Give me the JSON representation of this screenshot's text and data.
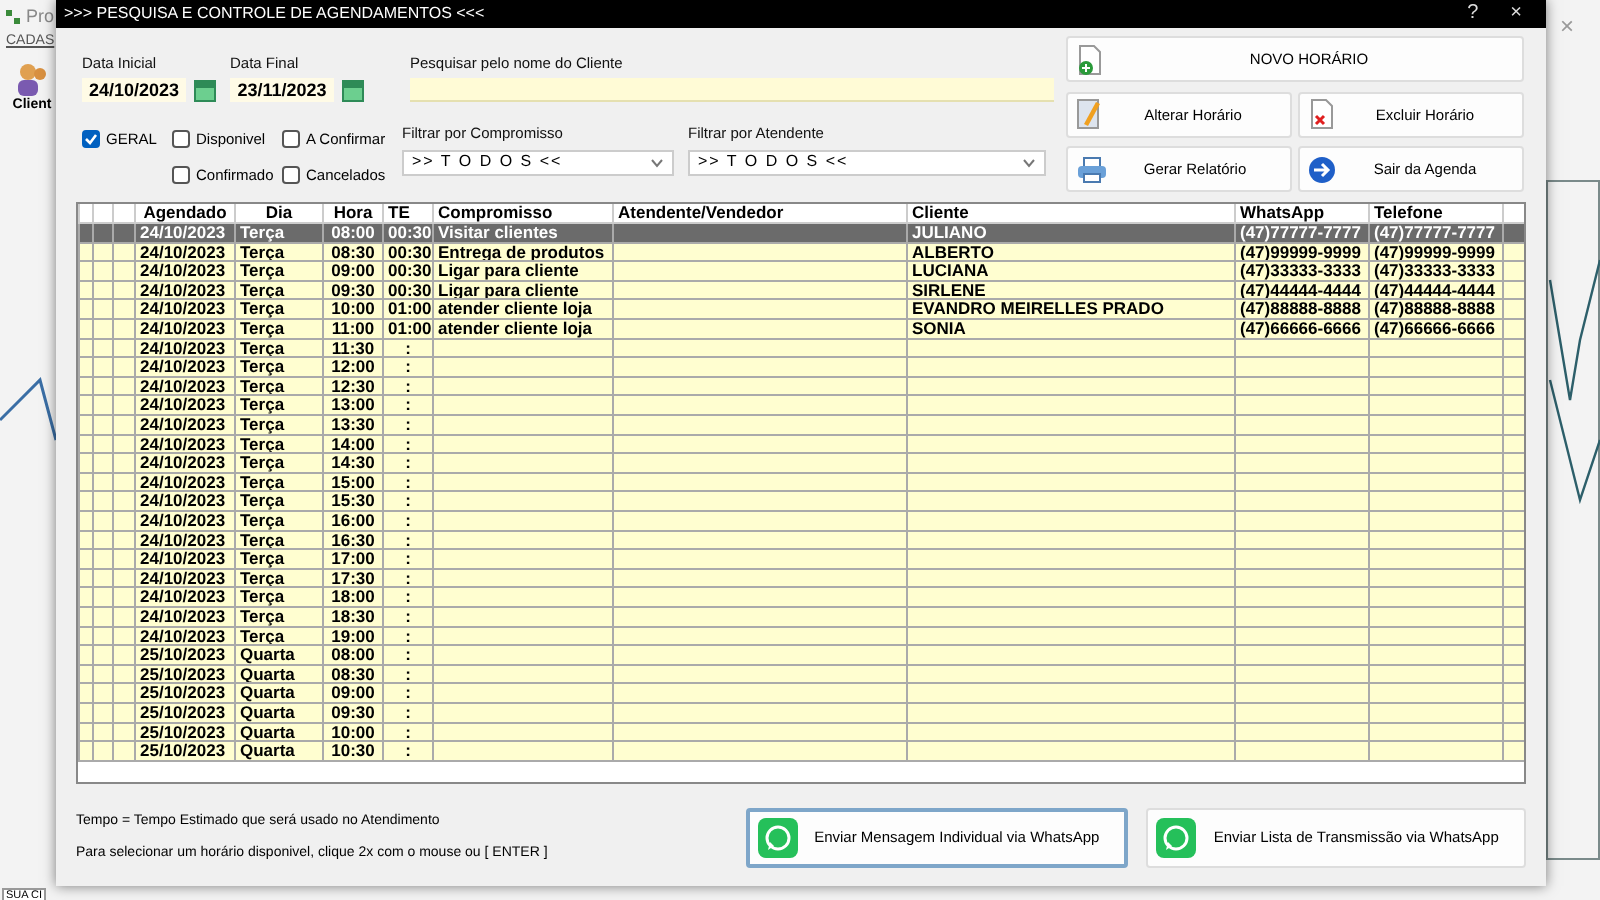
{
  "background_app": {
    "title": "Pro",
    "menu": "CADAS",
    "toolbar_label": "Client",
    "status_text": "SUA CI",
    "close": "×"
  },
  "dialog": {
    "title": ">>>  PESQUISA E CONTROLE DE AGENDAMENTOS  <<<",
    "help": "?",
    "close": "×"
  },
  "date_start": {
    "label": "Data Inicial",
    "value": "24/10/2023"
  },
  "date_end": {
    "label": "Data Final",
    "value": "23/11/2023"
  },
  "search": {
    "label": "Pesquisar pelo nome do Cliente"
  },
  "filters": [
    {
      "label": "GERAL",
      "checked": true
    },
    {
      "label": "Disponivel",
      "checked": false
    },
    {
      "label": "A Confirmar",
      "checked": false
    },
    {
      "label": "Confirmado",
      "checked": false
    },
    {
      "label": "Cancelados",
      "checked": false
    }
  ],
  "compromisso_filter": {
    "label": "Filtrar por Compromisso",
    "value": ">> T O D O S <<"
  },
  "atendente_filter": {
    "label": "Filtrar por Atendente",
    "value": ">> T O D O S <<"
  },
  "buttons": [
    {
      "label": "NOVO HORÁRIO",
      "kind": "new"
    },
    {
      "label": "Alterar Horário",
      "kind": "edit"
    },
    {
      "label": "Excluir Horário",
      "kind": "delete"
    },
    {
      "label": "Gerar Relatório",
      "kind": "report"
    },
    {
      "label": "Sair da Agenda",
      "kind": "exit"
    }
  ],
  "table": {
    "columns": [
      "Agendado",
      "Dia",
      "Hora",
      "TE",
      "Compromisso",
      "Atendente/Vendedor",
      "Cliente",
      "WhatsApp",
      "Telefone"
    ],
    "rows": [
      {
        "date": "24/10/2023",
        "day": "Terça",
        "time": "08:00",
        "te": "00:30",
        "appointment": "Visitar clientes",
        "client": "JULIANO",
        "whatsapp": "(47)77777-7777",
        "phone": "(47)77777-7777",
        "selected": true
      },
      {
        "date": "24/10/2023",
        "day": "Terça",
        "time": "08:30",
        "te": "00:30",
        "appointment": "Entrega de produtos",
        "client": "ALBERTO",
        "whatsapp": "(47)99999-9999",
        "phone": "(47)99999-9999",
        "selected": false
      },
      {
        "date": "24/10/2023",
        "day": "Terça",
        "time": "09:00",
        "te": "00:30",
        "appointment": "Ligar para cliente",
        "client": "LUCIANA",
        "whatsapp": "(47)33333-3333",
        "phone": "(47)33333-3333",
        "selected": false
      },
      {
        "date": "24/10/2023",
        "day": "Terça",
        "time": "09:30",
        "te": "00:30",
        "appointment": "Ligar para cliente",
        "client": "SIRLENE",
        "whatsapp": "(47)44444-4444",
        "phone": "(47)44444-4444",
        "selected": false
      },
      {
        "date": "24/10/2023",
        "day": "Terça",
        "time": "10:00",
        "te": "01:00",
        "appointment": "atender cliente loja",
        "client": "EVANDRO MEIRELLES PRADO",
        "whatsapp": "(47)88888-8888",
        "phone": "(47)88888-8888",
        "selected": false
      },
      {
        "date": "24/10/2023",
        "day": "Terça",
        "time": "11:00",
        "te": "01:00",
        "appointment": "atender cliente loja",
        "client": "SONIA",
        "whatsapp": "(47)66666-6666",
        "phone": "(47)66666-6666",
        "selected": false
      },
      {
        "date": "24/10/2023",
        "day": "Terça",
        "time": "11:30",
        "te": ":",
        "selected": false
      },
      {
        "date": "24/10/2023",
        "day": "Terça",
        "time": "12:00",
        "te": ":",
        "selected": false
      },
      {
        "date": "24/10/2023",
        "day": "Terça",
        "time": "12:30",
        "te": ":",
        "selected": false
      },
      {
        "date": "24/10/2023",
        "day": "Terça",
        "time": "13:00",
        "te": ":",
        "selected": false
      },
      {
        "date": "24/10/2023",
        "day": "Terça",
        "time": "13:30",
        "te": ":",
        "selected": false
      },
      {
        "date": "24/10/2023",
        "day": "Terça",
        "time": "14:00",
        "te": ":",
        "selected": false
      },
      {
        "date": "24/10/2023",
        "day": "Terça",
        "time": "14:30",
        "te": ":",
        "selected": false
      },
      {
        "date": "24/10/2023",
        "day": "Terça",
        "time": "15:00",
        "te": ":",
        "selected": false
      },
      {
        "date": "24/10/2023",
        "day": "Terça",
        "time": "15:30",
        "te": ":",
        "selected": false
      },
      {
        "date": "24/10/2023",
        "day": "Terça",
        "time": "16:00",
        "te": ":",
        "selected": false
      },
      {
        "date": "24/10/2023",
        "day": "Terça",
        "time": "16:30",
        "te": ":",
        "selected": false
      },
      {
        "date": "24/10/2023",
        "day": "Terça",
        "time": "17:00",
        "te": ":",
        "selected": false
      },
      {
        "date": "24/10/2023",
        "day": "Terça",
        "time": "17:30",
        "te": ":",
        "selected": false
      },
      {
        "date": "24/10/2023",
        "day": "Terça",
        "time": "18:00",
        "te": ":",
        "selected": false
      },
      {
        "date": "24/10/2023",
        "day": "Terça",
        "time": "18:30",
        "te": ":",
        "selected": false
      },
      {
        "date": "24/10/2023",
        "day": "Terça",
        "time": "19:00",
        "te": ":",
        "selected": false
      },
      {
        "date": "25/10/2023",
        "day": "Quarta",
        "time": "08:00",
        "te": ":",
        "selected": false
      },
      {
        "date": "25/10/2023",
        "day": "Quarta",
        "time": "08:30",
        "te": ":",
        "selected": false
      },
      {
        "date": "25/10/2023",
        "day": "Quarta",
        "time": "09:00",
        "te": ":",
        "selected": false
      },
      {
        "date": "25/10/2023",
        "day": "Quarta",
        "time": "09:30",
        "te": ":",
        "selected": false
      },
      {
        "date": "25/10/2023",
        "day": "Quarta",
        "time": "10:00",
        "te": ":",
        "selected": false
      },
      {
        "date": "25/10/2023",
        "day": "Quarta",
        "time": "10:30",
        "te": ":",
        "selected": false
      }
    ]
  },
  "notes": [
    "Tempo = Tempo Estimado que será usado no Atendimento",
    "Para selecionar um horário disponivel, clique 2x com o mouse ou [ ENTER ]"
  ],
  "whatsapp_buttons": [
    {
      "label": "Enviar Mensagem Individual via WhatsApp",
      "focused": true
    },
    {
      "label": "Enviar Lista de Transmissão via WhatsApp",
      "focused": false
    }
  ]
}
